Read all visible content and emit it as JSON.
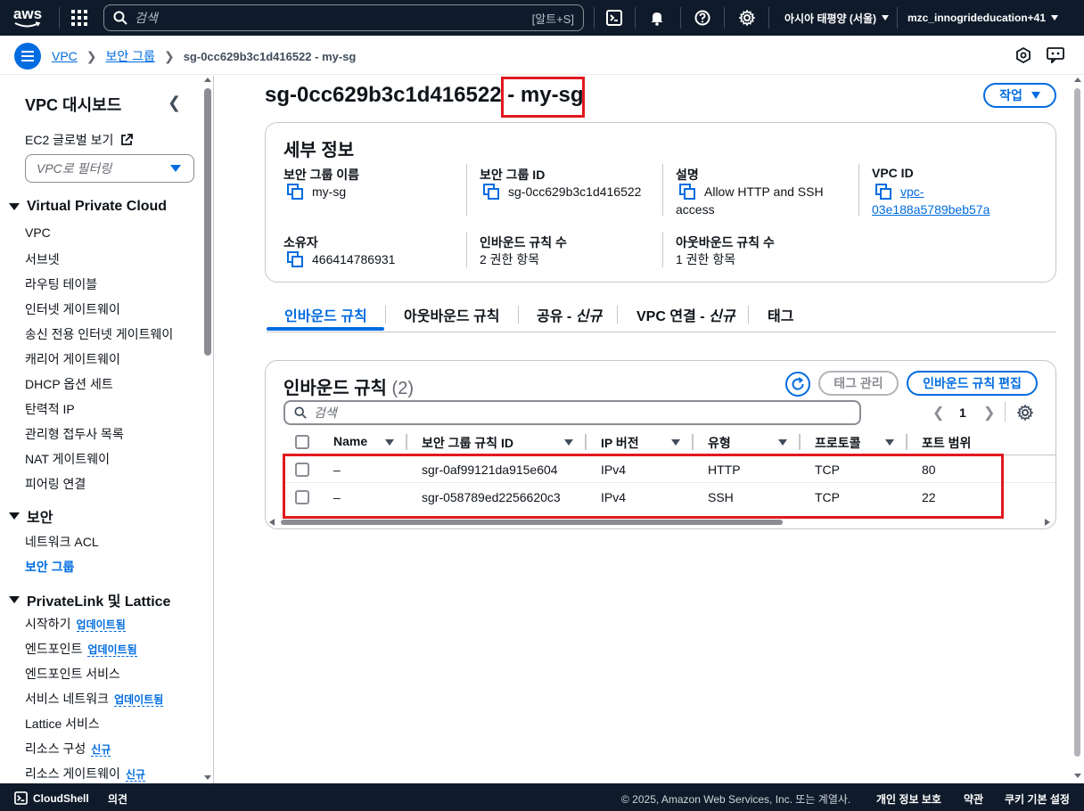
{
  "topnav": {
    "logo": "aws",
    "search_placeholder": "검색",
    "search_shortcut": "[알트+S]",
    "region": "아시아 태평양 (서울)",
    "account": "mzc_innogrideducation+41"
  },
  "breadcrumb": {
    "items": [
      "VPC",
      "보안 그룹"
    ],
    "current": "sg-0cc629b3c1d416522 - my-sg"
  },
  "sidebar": {
    "title": "VPC 대시보드",
    "ec2_global": "EC2 글로벌 보기",
    "filter_placeholder": "VPC로 필터링",
    "section_vpc": "Virtual Private Cloud",
    "vpc_items": [
      "VPC",
      "서브넷",
      "라우팅 테이블",
      "인터넷 게이트웨이",
      "송신 전용 인터넷 게이트웨이",
      "캐리어 게이트웨이",
      "DHCP 옵션 세트",
      "탄력적 IP",
      "관리형 접두사 목록",
      "NAT 게이트웨이",
      "피어링 연결"
    ],
    "section_security": "보안",
    "security_items": [
      "네트워크 ACL",
      "보안 그룹"
    ],
    "section_privatelink": "PrivateLink 및 Lattice",
    "pl_items": [
      {
        "label": "시작하기",
        "badge": "업데이트됨"
      },
      {
        "label": "엔드포인트",
        "badge": "업데이트됨"
      },
      {
        "label": "엔드포인트 서비스",
        "badge": ""
      },
      {
        "label": "서비스 네트워크",
        "badge": "업데이트됨"
      },
      {
        "label": "Lattice 서비스",
        "badge": ""
      },
      {
        "label": "리소스 구성",
        "badge": "신규"
      },
      {
        "label": "리소스 게이트웨이",
        "badge": "신규"
      }
    ]
  },
  "page": {
    "title_id": "sg-0cc629b3c1d416522",
    "title_sep": " - ",
    "title_name": "my-sg",
    "action_label": "작업"
  },
  "details": {
    "heading": "세부 정보",
    "sg_name_label": "보안 그룹 이름",
    "sg_name": "my-sg",
    "sg_id_label": "보안 그룹 ID",
    "sg_id": "sg-0cc629b3c1d416522",
    "desc_label": "설명",
    "desc_line1": "Allow HTTP and SSH",
    "desc_line2": "access",
    "vpc_label": "VPC ID",
    "vpc_line1": "vpc-",
    "vpc_line2": "03e188a5789beb57a",
    "owner_label": "소유자",
    "owner": "466414786931",
    "inbound_count_label": "인바운드 규칙 수",
    "inbound_count": "2 권한 항목",
    "outbound_count_label": "아웃바운드 규칙 수",
    "outbound_count": "1 권한 항목"
  },
  "tabs": {
    "inbound": "인바운드 규칙",
    "outbound": "아웃바운드 규칙",
    "share": "공유 - ",
    "share_new": "신규",
    "vpc_assoc": "VPC 연결 - ",
    "vpc_assoc_new": "신규",
    "tags": "태그"
  },
  "rules": {
    "heading": "인바운드 규칙",
    "count": "(2)",
    "manage_tags": "태그 관리",
    "edit_button": "인바운드 규칙 편집",
    "search_placeholder": "검색",
    "page": "1",
    "columns": [
      "Name",
      "보안 그룹 규칙 ID",
      "IP 버전",
      "유형",
      "프로토콜",
      "포트 범위"
    ],
    "rows": [
      {
        "name": "–",
        "id": "sgr-0af99121da915e604",
        "ip": "IPv4",
        "type": "HTTP",
        "proto": "TCP",
        "port": "80"
      },
      {
        "name": "–",
        "id": "sgr-058789ed2256620c3",
        "ip": "IPv4",
        "type": "SSH",
        "proto": "TCP",
        "port": "22"
      }
    ]
  },
  "footer": {
    "cloudshell": "CloudShell",
    "feedback": "의견",
    "copyright": "© 2025, Amazon Web Services, Inc. 또는 계열사.",
    "privacy": "개인 정보 보호",
    "terms": "약관",
    "cookies": "쿠키 기본 설정"
  },
  "colors": {
    "nav_bg": "#0f1b2a",
    "accent": "#006ce0",
    "highlight_box": "#e0191f"
  }
}
